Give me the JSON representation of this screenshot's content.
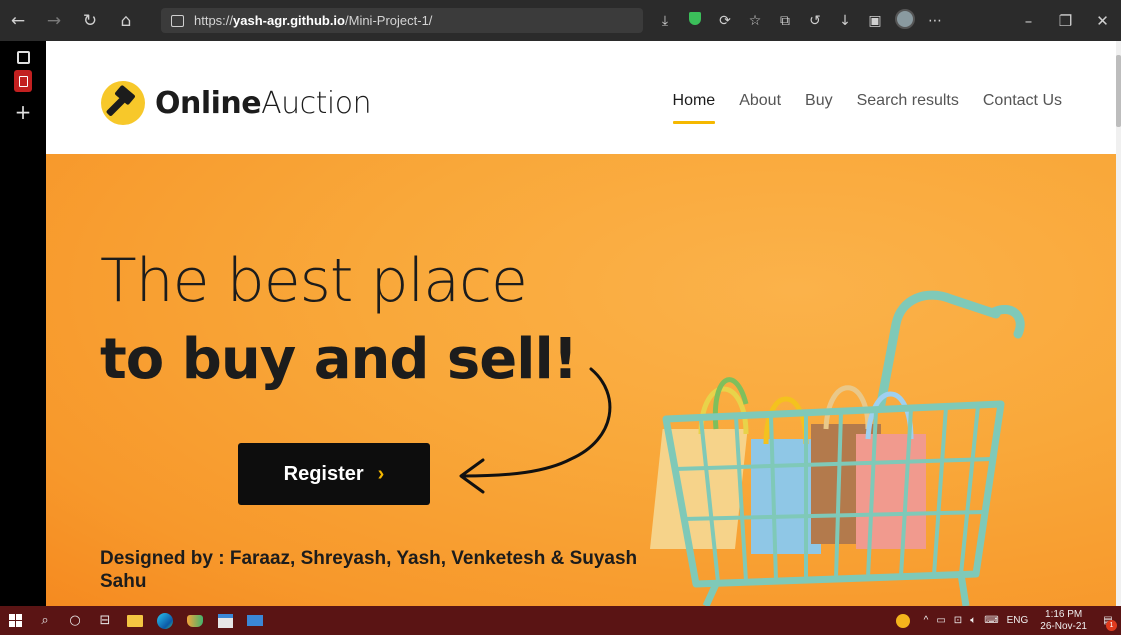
{
  "browser": {
    "url_prefix": "https://",
    "url_domain": "yash-agr.github.io",
    "url_path": "/Mini-Project-1/",
    "back_icon": "back-arrow-icon",
    "forward_icon": "forward-arrow-icon"
  },
  "site": {
    "logo_bold": "Online",
    "logo_light": "Auction",
    "nav": [
      {
        "label": "Home"
      },
      {
        "label": "About"
      },
      {
        "label": "Buy"
      },
      {
        "label": "Search results"
      },
      {
        "label": "Contact Us"
      }
    ],
    "hero_line1": "The best place",
    "hero_line2": "to buy and sell!",
    "register_label": "Register",
    "register_chevron": "›",
    "designed_by": "Designed by : Faraaz, Shreyash, Yash, Venketesh & Suyash Sahu",
    "accent_color": "#f5b800",
    "hero_color": "#f9a83a"
  },
  "taskbar": {
    "language": "ENG",
    "time": "1:16 PM",
    "date": "26-Nov-21",
    "notification_count": "1"
  }
}
